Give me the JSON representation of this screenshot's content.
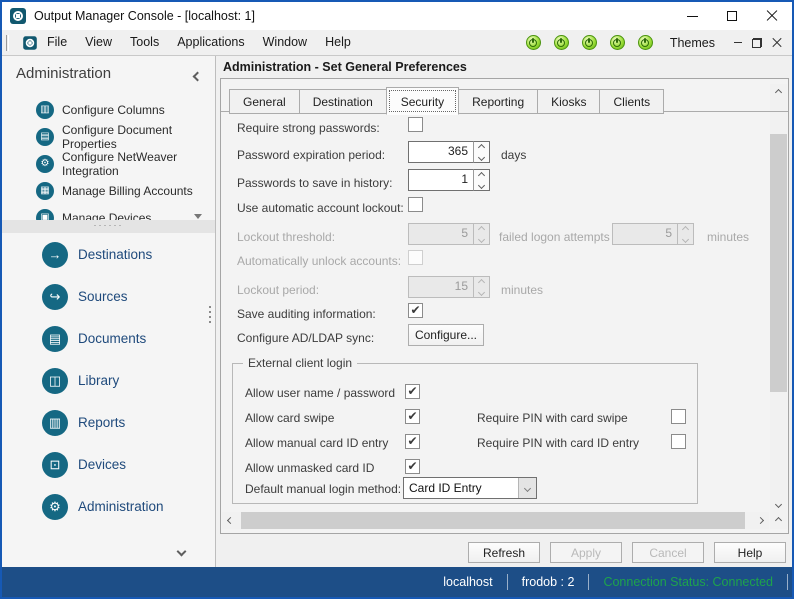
{
  "window": {
    "title": "Output Manager Console - [localhost: 1]"
  },
  "menu": {
    "items": [
      "File",
      "View",
      "Tools",
      "Applications",
      "Window",
      "Help"
    ],
    "themes_label": "Themes"
  },
  "sidebar": {
    "header": "Administration",
    "tasks": [
      {
        "label": "Configure Columns",
        "glyph": "▥"
      },
      {
        "label": "Configure Document Properties",
        "glyph": "▤"
      },
      {
        "label": "Configure NetWeaver Integration",
        "glyph": "⚙"
      },
      {
        "label": "Manage Billing Accounts",
        "glyph": "▦"
      },
      {
        "label": "Manage Devices",
        "glyph": "▣"
      }
    ],
    "drag_dots": "······",
    "sections": [
      {
        "label": "Destinations",
        "glyph": "→"
      },
      {
        "label": "Sources",
        "glyph": "↪"
      },
      {
        "label": "Documents",
        "glyph": "▤"
      },
      {
        "label": "Library",
        "glyph": "◫"
      },
      {
        "label": "Reports",
        "glyph": "▥"
      },
      {
        "label": "Devices",
        "glyph": "⊡"
      },
      {
        "label": "Administration",
        "glyph": "⚙"
      }
    ]
  },
  "main": {
    "heading": "Administration - Set General Preferences",
    "tabs": [
      "General",
      "Destination",
      "Security",
      "Reporting",
      "Kiosks",
      "Clients"
    ],
    "active_tab": "Security",
    "form": {
      "require_strong_label": "Require strong passwords:",
      "require_strong_check": "",
      "expiration_label": "Password expiration period:",
      "expiration_value": "365",
      "expiration_unit": "days",
      "history_label": "Passwords to save in history:",
      "history_value": "1",
      "lockout_enable_label": "Use automatic account lockout:",
      "lockout_enable_check": "",
      "threshold_label": "Lockout threshold:",
      "threshold_value": "5",
      "threshold_mid": "failed logon attempts in",
      "threshold_window_value": "5",
      "threshold_unit": "minutes",
      "auto_unlock_label": "Automatically unlock accounts:",
      "auto_unlock_check": "",
      "period_label": "Lockout period:",
      "period_value": "15",
      "period_unit": "minutes",
      "auditing_label": "Save auditing information:",
      "auditing_check": "✔",
      "adldap_label": "Configure AD/LDAP sync:",
      "adldap_button": "Configure..."
    },
    "group": {
      "title": "External client login",
      "rows": [
        {
          "label": "Allow user name / password",
          "check": "✔"
        },
        {
          "label": "Allow card swipe",
          "check": "✔",
          "right_label": "Require PIN with card swipe",
          "right_check": ""
        },
        {
          "label": "Allow manual card ID entry",
          "check": "✔",
          "right_label": "Require  PIN with card ID entry",
          "right_check": ""
        },
        {
          "label": "Allow unmasked card ID",
          "check": "✔"
        }
      ],
      "method_label": "Default manual login method:",
      "method_value": "Card ID Entry"
    },
    "buttons": [
      {
        "label": "Refresh",
        "enabled": true
      },
      {
        "label": "Apply",
        "enabled": false
      },
      {
        "label": "Cancel",
        "enabled": false
      },
      {
        "label": "Help",
        "enabled": true
      }
    ]
  },
  "statusbar": {
    "host": "localhost",
    "user": "frodob : 2",
    "connection": "Connection Status: Connected",
    "connection_color": "#1ea34c"
  },
  "colors": {
    "accent_teal": "#156883",
    "statusbar_blue": "#1d4e87",
    "window_border": "#1659b5"
  }
}
